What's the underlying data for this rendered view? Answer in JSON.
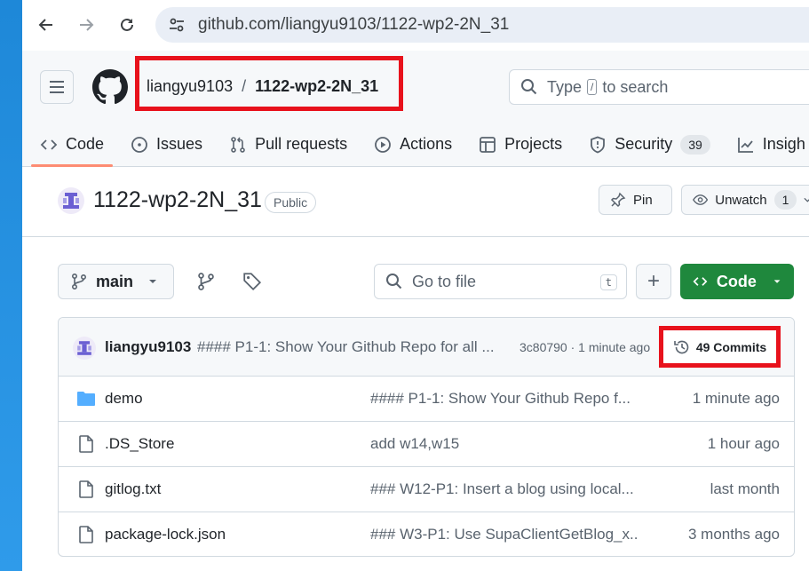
{
  "browser": {
    "url": "github.com/liangyu9103/1122-wp2-2N_31"
  },
  "header": {
    "owner": "liangyu9103",
    "separator": "/",
    "repo": "1122-wp2-2N_31",
    "search_prefix": "Type",
    "search_slash": "/",
    "search_suffix": "to search"
  },
  "tabs": [
    {
      "label": "Code",
      "icon": "code-icon",
      "active": true
    },
    {
      "label": "Issues",
      "icon": "issue-icon"
    },
    {
      "label": "Pull requests",
      "icon": "pull-request-icon"
    },
    {
      "label": "Actions",
      "icon": "play-icon"
    },
    {
      "label": "Projects",
      "icon": "table-icon"
    },
    {
      "label": "Security",
      "icon": "shield-icon",
      "counter": "39"
    },
    {
      "label": "Insigh",
      "icon": "graph-icon"
    }
  ],
  "repo": {
    "name": "1122-wp2-2N_31",
    "visibility": "Public",
    "pin_label": "Pin",
    "unwatch_label": "Unwatch",
    "watch_count": "1"
  },
  "toolbar": {
    "branch": "main",
    "goto_placeholder": "Go to file",
    "goto_shortcut": "t",
    "plus": "+",
    "code_label": "Code"
  },
  "latest_commit": {
    "author": "liangyu9103",
    "message": "#### P1-1: Show Your Github Repo for all ...",
    "meta": "3c80790 · 1 minute ago",
    "commits_label": "49 Commits"
  },
  "files": [
    {
      "type": "folder",
      "name": "demo",
      "message": "#### P1-1: Show Your Github Repo f...",
      "time": "1 minute ago"
    },
    {
      "type": "file",
      "name": ".DS_Store",
      "message": "add w14,w15",
      "time": "1 hour ago"
    },
    {
      "type": "file",
      "name": "gitlog.txt",
      "message": "### W12-P1: Insert a blog using local...",
      "time": "last month"
    },
    {
      "type": "file",
      "name": "package-lock.json",
      "message": "### W3-P1: Use SupaClientGetBlog_x...",
      "time": "3 months ago"
    }
  ],
  "colors": {
    "highlight": "#e8121c",
    "code_button": "#1f883d",
    "tab_underline": "#fd8c73"
  }
}
